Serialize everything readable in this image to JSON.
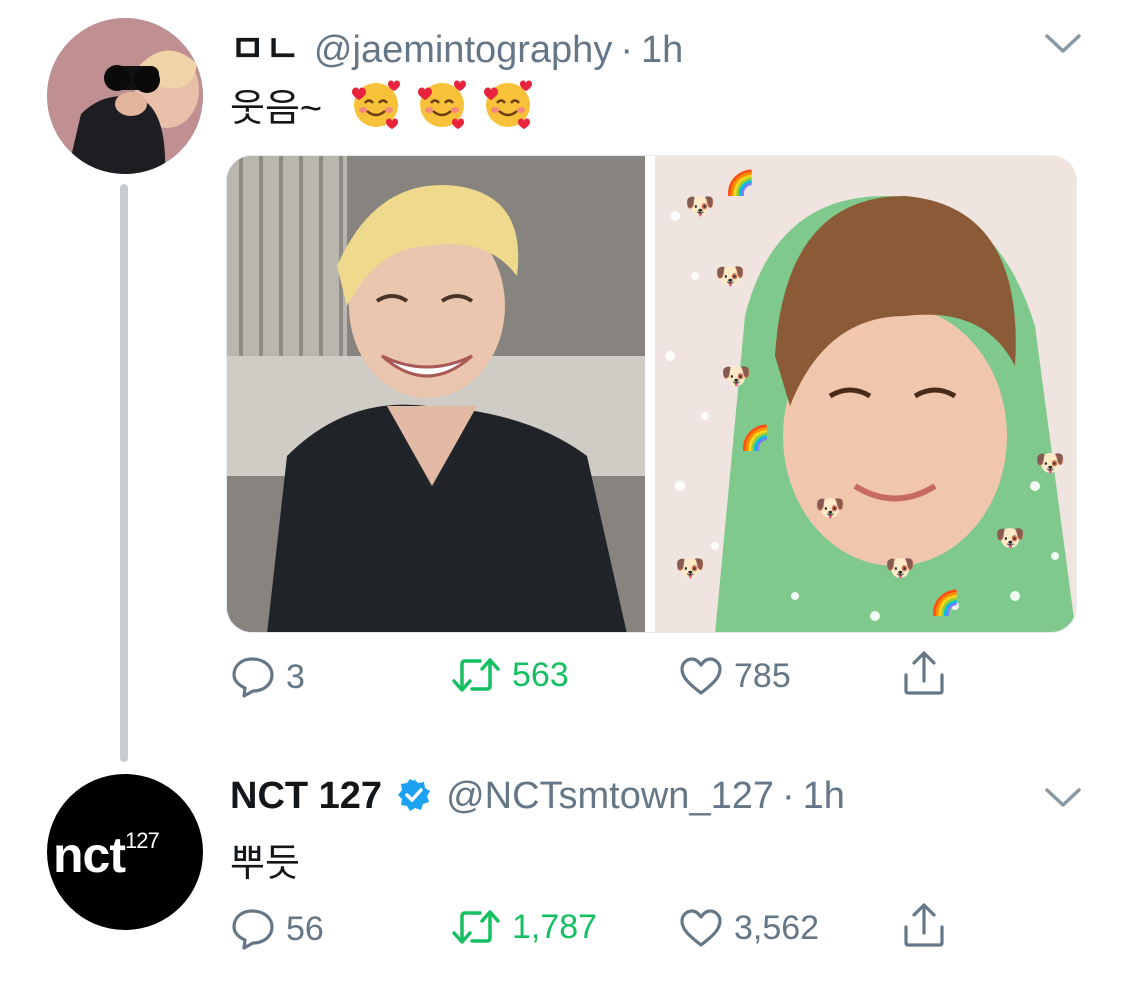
{
  "tweets": [
    {
      "name": "ㅁㄴ",
      "handle": "@jaemintography",
      "separator": "·",
      "time": "1h",
      "text": "웃음~",
      "emojis": [
        "smiling-face-with-hearts",
        "smiling-face-with-hearts",
        "smiling-face-with-hearts"
      ],
      "replies": "3",
      "retweets": "563",
      "likes": "785"
    },
    {
      "name": "NCT 127",
      "verified": true,
      "handle": "@NCTsmtown_127",
      "separator": "·",
      "time": "1h",
      "text": "뿌듯",
      "avatar_logo": {
        "main": "nct",
        "sup": "127"
      },
      "replies": "56",
      "retweets": "1,787",
      "likes": "3,562"
    }
  ],
  "colors": {
    "text": "#14171a",
    "secondary": "#657786",
    "retweet": "#17bf63",
    "verified": "#1da1f2",
    "thread": "#c7ccd1"
  }
}
